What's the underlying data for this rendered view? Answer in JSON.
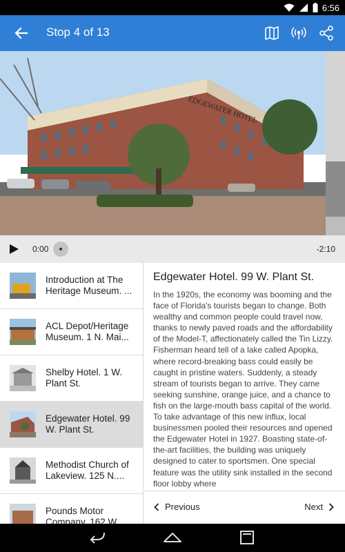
{
  "status_bar": {
    "time": "6:56",
    "icons": [
      "wifi-icon",
      "signal-icon",
      "battery-icon"
    ]
  },
  "app_bar": {
    "title": "Stop 4 of 13",
    "actions": [
      "map-icon",
      "broadcast-icon",
      "share-icon"
    ],
    "color": "#2f7fd6"
  },
  "hero": {
    "sign_text": "EDGEWATER HOTEL"
  },
  "player": {
    "elapsed": "0:00",
    "remaining": "-2:10"
  },
  "stops": [
    {
      "label": "Introduction at The Heritage Museum. ...",
      "active": false
    },
    {
      "label": "ACL Depot/Heritage Museum. 1 N. Mai...",
      "active": false
    },
    {
      "label": "Shelby Hotel.  1 W. Plant St.",
      "active": false
    },
    {
      "label": "Edgewater Hotel.  99 W. Plant St.",
      "active": true
    },
    {
      "label": "Methodist Church of Lakeview.  125 N....",
      "active": false
    },
    {
      "label": "Pounds Motor Company.  162 W...",
      "active": false
    }
  ],
  "detail": {
    "title": "Edgewater Hotel.  99 W. Plant St.",
    "body": "In the 1920s, the economy was booming and the face of Florida's tourists began to change. Both wealthy and common people could travel now, thanks to newly paved roads and the affordability of the Model-T, affectionately called the Tin Lizzy. Fisherman heard tell of a lake called Apopka, where record-breaking bass could easily be caught in pristine waters. Suddenly, a steady stream of tourists began to arrive. They came seeking sunshine, orange juice, and a chance to fish on the large-mouth bass capital of the world. To take advantage of this new influx, local businessmen pooled their resources and opened the Edgewater Hotel in 1927. Boasting state-of-the-art facilities, the building was uniquely designed to cater to sportsmen. One special feature was the utility sink installed in the second floor lobby where",
    "prev_label": "Previous",
    "next_label": "Next"
  },
  "nav_bar": [
    "back-icon",
    "home-icon",
    "recents-icon"
  ]
}
